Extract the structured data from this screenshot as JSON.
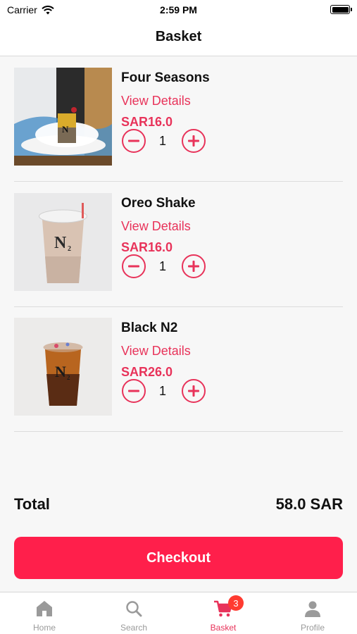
{
  "status_bar": {
    "carrier": "Carrier",
    "time": "2:59 PM"
  },
  "nav": {
    "title": "Basket"
  },
  "items": [
    {
      "name": "Four Seasons",
      "details_link": "View Details",
      "price": "SAR16.0",
      "quantity": "1"
    },
    {
      "name": "Oreo Shake",
      "details_link": "View Details",
      "price": "SAR16.0",
      "quantity": "1"
    },
    {
      "name": "Black N2",
      "details_link": "View Details",
      "price": "SAR26.0",
      "quantity": "1"
    }
  ],
  "summary": {
    "total_label": "Total",
    "total_value": "58.0 SAR"
  },
  "checkout": {
    "label": "Checkout"
  },
  "tab_bar": {
    "tabs": [
      {
        "label": "Home",
        "icon": "home-icon"
      },
      {
        "label": "Search",
        "icon": "search-icon"
      },
      {
        "label": "Basket",
        "icon": "cart-icon",
        "badge": "3"
      },
      {
        "label": "Profile",
        "icon": "person-icon"
      }
    ]
  },
  "colors": {
    "accent": "#e8335a",
    "checkout": "#ff1f4b",
    "badge": "#ff3b30",
    "tab_inactive": "#9a9a9a"
  }
}
